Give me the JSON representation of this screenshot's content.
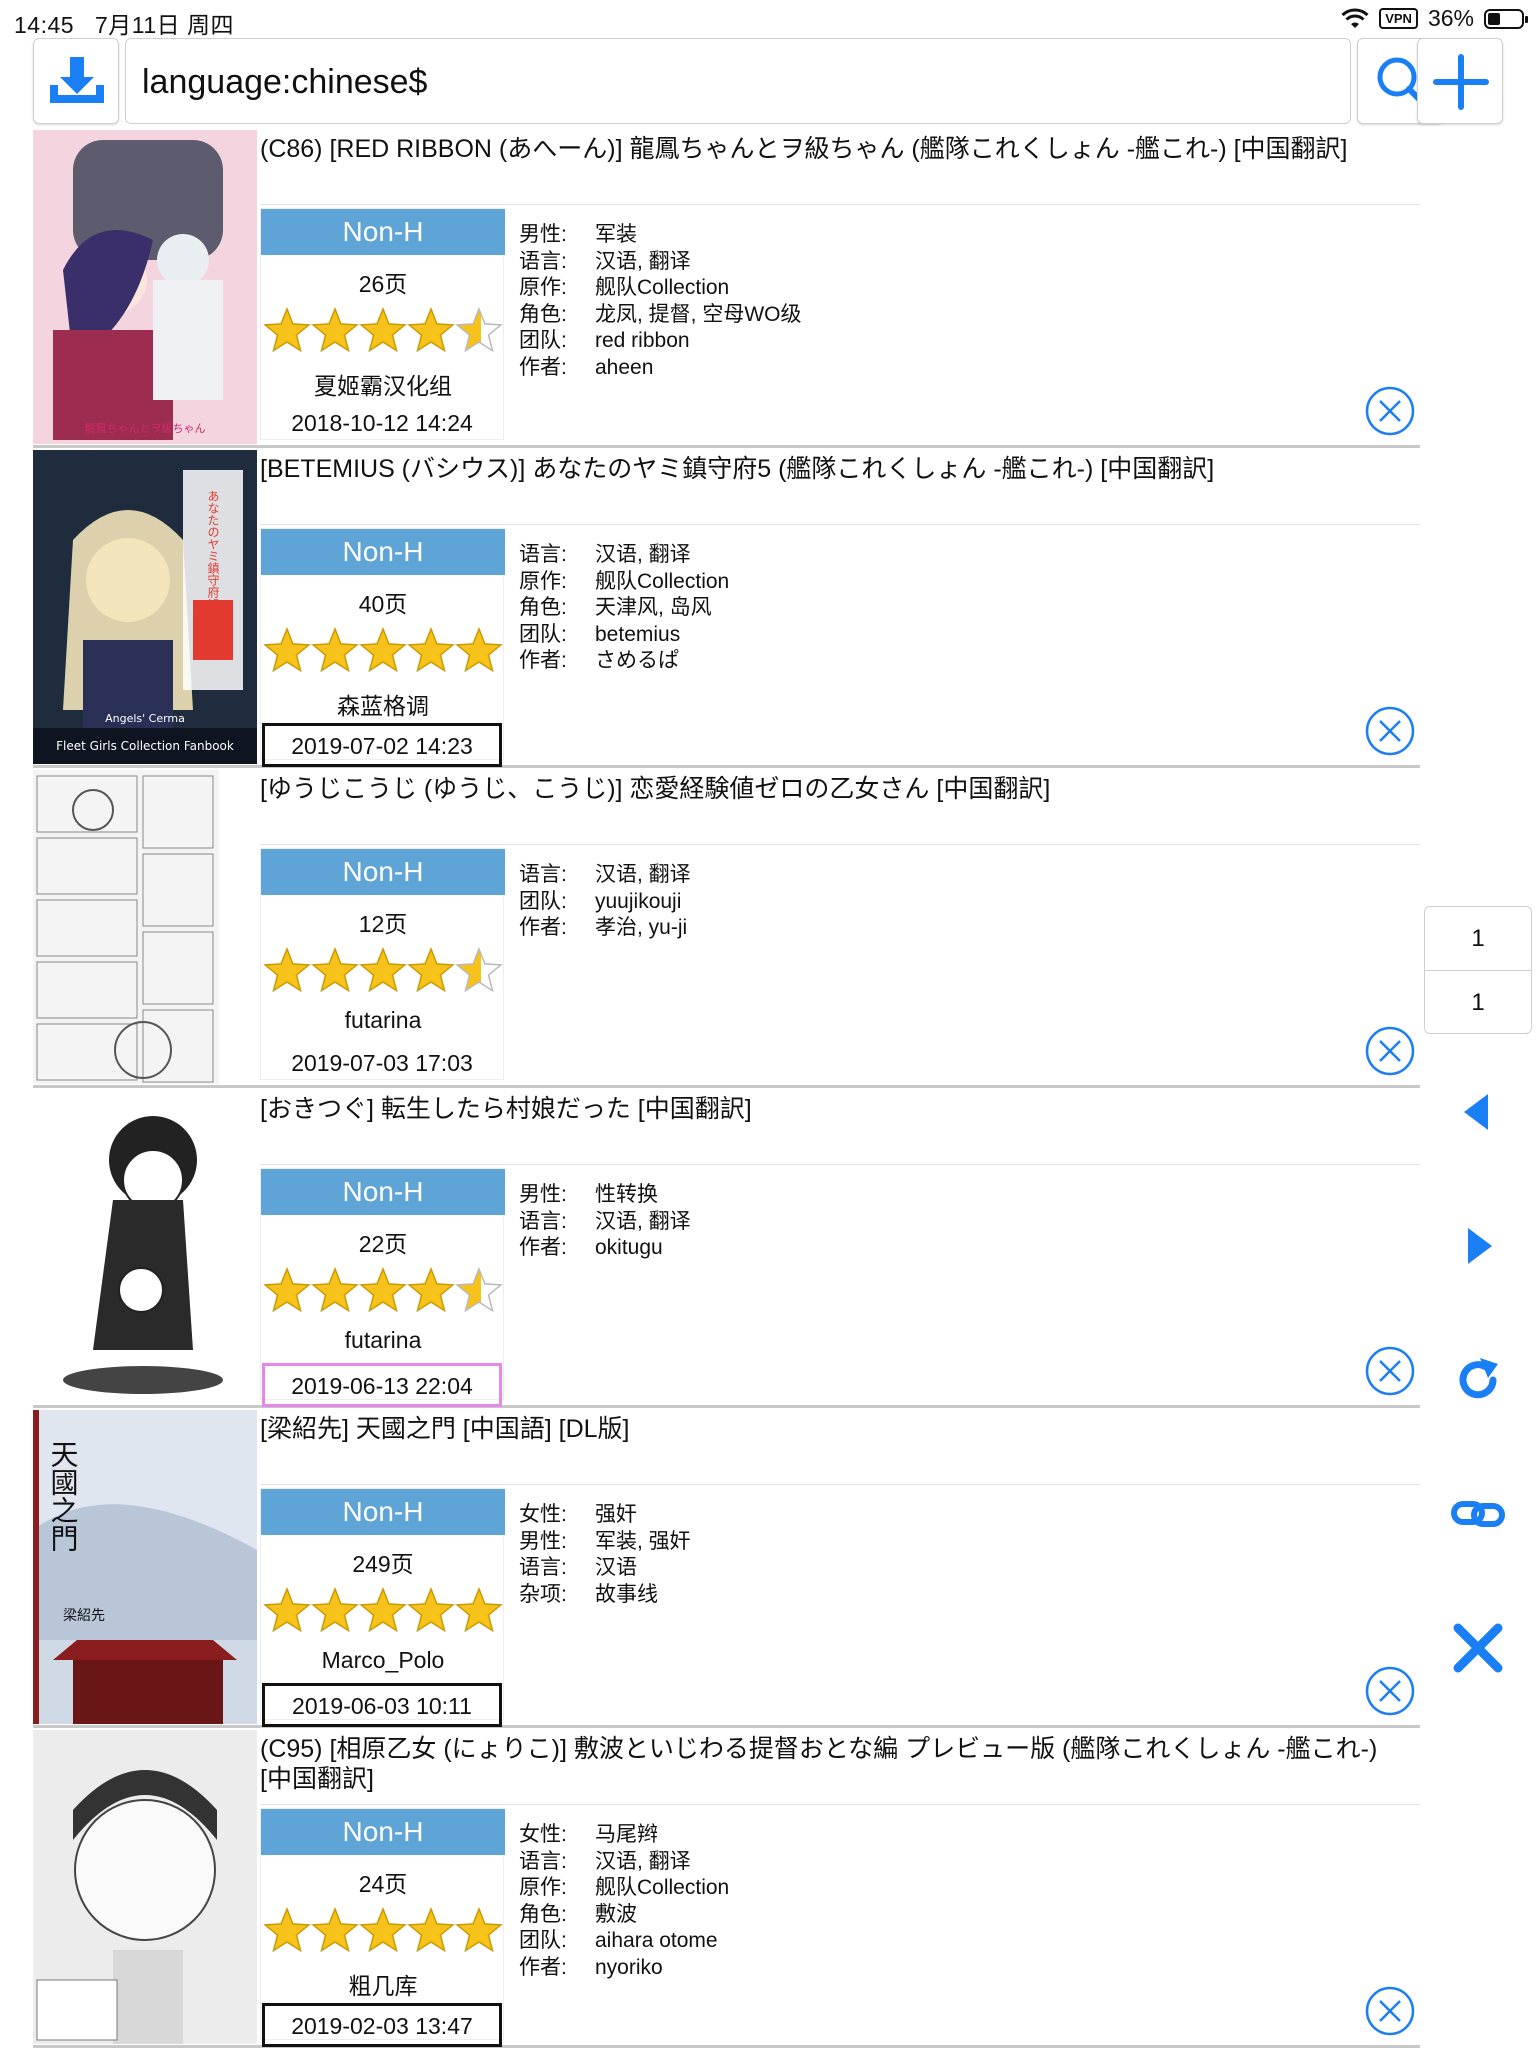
{
  "status": {
    "time": "14:45",
    "date": "7月11日 周四",
    "vpn": "VPN",
    "battery_percent": "36%",
    "battery_level": 0.36
  },
  "toolbar": {
    "search_value": "language:chinese$",
    "download_icon": "download-icon",
    "search_icon": "search-icon",
    "add_icon": "plus-icon"
  },
  "gallery": [
    {
      "title": "(C86) [RED RIBBON (あへーん)] 龍鳳ちゃんとヲ級ちゃん (艦隊これくしょん -艦これ-) [中国翻訳]",
      "category": "Non-H",
      "pages": "26页",
      "rating": 4.5,
      "uploader": "夏姬霸汉化组",
      "date": "2018-10-12 14:24",
      "date_style": "none",
      "tags": [
        {
          "k": "男性:",
          "v": "军装"
        },
        {
          "k": "语言:",
          "v": "汉语, 翻译"
        },
        {
          "k": "原作:",
          "v": "舰队Collection"
        },
        {
          "k": "角色:",
          "v": "龙凤, 提督, 空母WO级"
        },
        {
          "k": "团队:",
          "v": "red ribbon"
        },
        {
          "k": "作者:",
          "v": "aheen"
        }
      ],
      "cover": {
        "bg": "#f3d4df",
        "accent": "#7a4a8c",
        "text": "龍鳳ちゃんとヲ級ちゃん"
      }
    },
    {
      "title": "[BETEMIUS (バシウス)] あなたのヤミ鎮守府5 (艦隊これくしょん -艦これ-) [中国翻訳]",
      "category": "Non-H",
      "pages": "40页",
      "rating": 5,
      "uploader": "森蓝格调",
      "date": "2019-07-02 14:23",
      "date_style": "boxed",
      "tags": [
        {
          "k": "语言:",
          "v": "汉语, 翻译"
        },
        {
          "k": "原作:",
          "v": "舰队Collection"
        },
        {
          "k": "角色:",
          "v": "天津风, 岛风"
        },
        {
          "k": "团队:",
          "v": "betemius"
        },
        {
          "k": "作者:",
          "v": "さめるぱ"
        }
      ],
      "cover": {
        "bg": "#2b3a4e",
        "accent": "#e23a2f",
        "text": "あなたのヤミ鎮守府5",
        "sub": "Fleet Girls Collection Fanbook",
        "sub2": "Angels' Cerma"
      }
    },
    {
      "title": "[ゆうじこうじ (ゆうじ、こうじ)] 恋愛経験値ゼロの乙女さん [中国翻訳]",
      "category": "Non-H",
      "pages": "12页",
      "rating": 4.5,
      "uploader": "futarina",
      "date": "2019-07-03 17:03",
      "date_style": "none",
      "tags": [
        {
          "k": "语言:",
          "v": "汉语, 翻译"
        },
        {
          "k": "团队:",
          "v": "yuujikouji"
        },
        {
          "k": "作者:",
          "v": "孝治, yu-ji"
        }
      ],
      "cover": {
        "bg": "#f4f4f4",
        "accent": "#555555"
      }
    },
    {
      "title": "[おきつぐ] 転生したら村娘だった [中国翻訳]",
      "category": "Non-H",
      "pages": "22页",
      "rating": 4.5,
      "uploader": "futarina",
      "date": "2019-06-13 22:04",
      "date_style": "pink",
      "tags": [
        {
          "k": "男性:",
          "v": "性转换"
        },
        {
          "k": "语言:",
          "v": "汉语, 翻译"
        },
        {
          "k": "作者:",
          "v": "okitugu"
        }
      ],
      "cover": {
        "bg": "#ffffff",
        "accent": "#222222"
      }
    },
    {
      "title": "[梁紹先] 天國之門 [中国語] [DL版]",
      "category": "Non-H",
      "pages": "249页",
      "rating": 5,
      "uploader": "Marco_Polo",
      "date": "2019-06-03 10:11",
      "date_style": "boxed",
      "tags": [
        {
          "k": "女性:",
          "v": "强奸"
        },
        {
          "k": "男性:",
          "v": "军装, 强奸"
        },
        {
          "k": "语言:",
          "v": "汉语"
        },
        {
          "k": "杂项:",
          "v": "故事线"
        }
      ],
      "cover": {
        "bg": "#cfd9e6",
        "accent": "#8a1e1e",
        "text": "天國之門",
        "sub": "梁紹先"
      }
    },
    {
      "title": "(C95) [相原乙女 (にょりこ)] 敷波といじわる提督おとな編 プレビュー版 (艦隊これくしょん -艦これ-) [中国翻訳]",
      "category": "Non-H",
      "pages": "24页",
      "rating": 5,
      "uploader": "粗几库",
      "date": "2019-02-03 13:47",
      "date_style": "boxed",
      "tags": [
        {
          "k": "女性:",
          "v": "马尾辫"
        },
        {
          "k": "语言:",
          "v": "汉语, 翻译"
        },
        {
          "k": "原作:",
          "v": "舰队Collection"
        },
        {
          "k": "角色:",
          "v": "敷波"
        },
        {
          "k": "团队:",
          "v": "aihara otome"
        },
        {
          "k": "作者:",
          "v": "nyoriko"
        }
      ],
      "cover": {
        "bg": "#ececec",
        "accent": "#333333"
      }
    }
  ],
  "pager": {
    "current": "1",
    "total": "1"
  },
  "sidebar_icons": [
    "prev-page-icon",
    "next-page-icon",
    "refresh-icon",
    "link-icon",
    "close-icon"
  ],
  "colors": {
    "accent": "#1a7ff5",
    "category_nonh": "#5fa4d6",
    "star": "#f7c21a",
    "pink_border": "#e887ea"
  }
}
